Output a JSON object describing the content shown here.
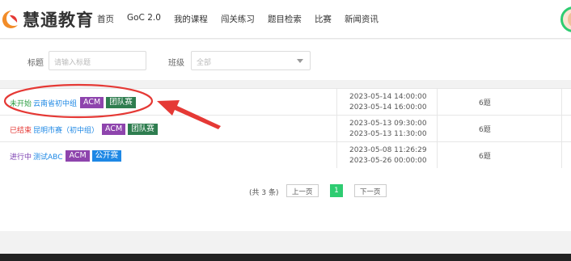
{
  "brand": {
    "name": "慧通教育"
  },
  "nav": [
    {
      "label": "首页"
    },
    {
      "label": "GoC 2.0"
    },
    {
      "label": "我的课程"
    },
    {
      "label": "闯关练习"
    },
    {
      "label": "题目检索"
    },
    {
      "label": "比赛"
    },
    {
      "label": "新闻资讯"
    }
  ],
  "filters": {
    "title_label": "标题",
    "title_placeholder": "请输入标题",
    "class_label": "班级",
    "class_value": "全部"
  },
  "contests": [
    {
      "status": "未开始",
      "status_color": "#2e9e44",
      "name": "云南省初中组",
      "tags": [
        {
          "label": "ACM",
          "color": "#8e44ad"
        },
        {
          "label": "团队赛",
          "color": "#2e7d4f"
        }
      ],
      "start": "2023-05-14 14:00:00",
      "end": "2023-05-14 16:00:00",
      "problems": "6题"
    },
    {
      "status": "已结束",
      "status_color": "#e53935",
      "name": "昆明市赛（初中组）",
      "tags": [
        {
          "label": "ACM",
          "color": "#8e44ad"
        },
        {
          "label": "团队赛",
          "color": "#2e7d4f"
        }
      ],
      "start": "2023-05-13 09:30:00",
      "end": "2023-05-13 11:30:00",
      "problems": "6题"
    },
    {
      "status": "进行中",
      "status_color": "#7b3fb0",
      "name": "测试ABC",
      "tags": [
        {
          "label": "ACM",
          "color": "#8e44ad"
        },
        {
          "label": "公开赛",
          "color": "#1e88e5"
        }
      ],
      "start": "2023-05-08 11:26:29",
      "end": "2023-05-26 00:00:00",
      "problems": "6题"
    }
  ],
  "pagination": {
    "total": "(共 3 条)",
    "prev": "上一页",
    "current": "1",
    "next": "下一页"
  },
  "colors": {
    "accent": "#2ecc71",
    "annotation": "#e53935"
  }
}
